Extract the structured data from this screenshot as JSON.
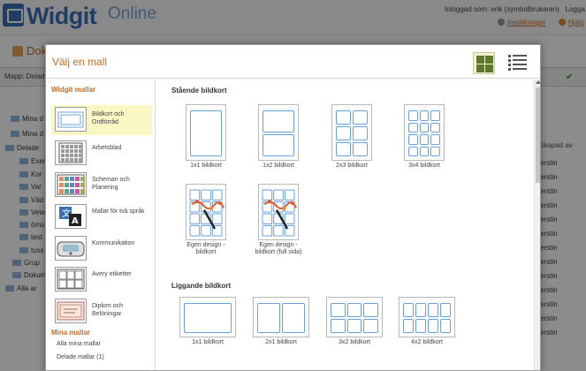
{
  "app": {
    "logo_text": "Widgit",
    "logo_suffix": "Online",
    "login_info": "Inloggad som: erik (symbolbrukaren)",
    "logout": "Logga ut",
    "settings": "Inställningar",
    "help": "Hjälp",
    "page_title": "Dokument",
    "folder_label": "Mapp: Delade",
    "tree": [
      "Mina d",
      "Mina d",
      "Delade",
      "Exem",
      "Kor",
      "Var",
      "Väd",
      "Vete",
      "öms",
      "test",
      "tuss",
      "Grup",
      "Dokum",
      "Alla ar"
    ],
    "column_header": "Skapad av",
    "column_values": [
      "erstin",
      "erstin",
      "erstin",
      "erstin",
      "erstin",
      "erstin",
      "erstin",
      "erstin",
      "erstin",
      "erstin",
      "erstin",
      "erstin",
      "erstin"
    ]
  },
  "modal": {
    "title": "Välj en mall",
    "view_grid_icon": "grid-view-icon",
    "view_list_icon": "list-view-icon",
    "sidebar": {
      "widgit_heading": "Widgit mallar",
      "categories": [
        {
          "label": "Bildkort och Ordförråd",
          "icon": "flashcard-icon",
          "active": true
        },
        {
          "label": "Arbetsblad",
          "icon": "worksheet-icon",
          "active": false
        },
        {
          "label": "Scheman och Planering",
          "icon": "schedule-icon",
          "active": false
        },
        {
          "label": "Mallar för två språk",
          "icon": "translate-icon",
          "active": false
        },
        {
          "label": "Kommunikation",
          "icon": "communication-device-icon",
          "active": false
        },
        {
          "label": "Avery etiketter",
          "icon": "label-sheet-icon",
          "active": false
        },
        {
          "label": "Diplom och Belöningar",
          "icon": "certificate-icon",
          "active": false
        }
      ],
      "my_heading": "Mina mallar",
      "my_links": [
        "Alla mina mallar",
        "Delade mallar (1)"
      ]
    },
    "sections": [
      {
        "title": "Stående bildkort",
        "tiles": [
          {
            "caption": "1x1 bildkort",
            "cols": 1,
            "rows": 1
          },
          {
            "caption": "1x2 bildkort",
            "cols": 1,
            "rows": 2
          },
          {
            "caption": "2x3 bildkort",
            "cols": 2,
            "rows": 3
          },
          {
            "caption": "3x4 bildkort",
            "cols": 3,
            "rows": 4
          },
          {
            "caption": "Egen design - bildkort",
            "cols": 0,
            "rows": 0
          },
          {
            "caption": "Egen design - bildkort (full sida)",
            "cols": 0,
            "rows": 0
          }
        ]
      },
      {
        "title": "Liggande bildkort",
        "tiles": [
          {
            "caption": "1x1 bildkort",
            "cols": 1,
            "rows": 1
          },
          {
            "caption": "2x1 bildkort",
            "cols": 2,
            "rows": 1
          },
          {
            "caption": "3x2 bildkort",
            "cols": 3,
            "rows": 2
          },
          {
            "caption": "4x2 bildkort",
            "cols": 4,
            "rows": 2
          }
        ]
      }
    ]
  },
  "colors": {
    "accent": "#c56a2a",
    "brand": "#3b6fb6",
    "card_line": "#6aa0d8",
    "active_bg": "#fbf7c2"
  }
}
